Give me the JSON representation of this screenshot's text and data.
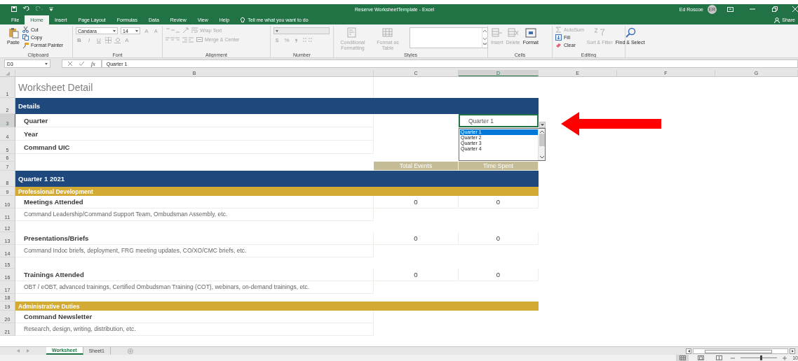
{
  "window": {
    "title": "Reserve WorksheetTemplate  -  Excel",
    "user": "Ed Roscoe",
    "avatar": "ER"
  },
  "ribbon_tabs": [
    {
      "label": "File",
      "selected": false
    },
    {
      "label": "Home",
      "selected": true
    },
    {
      "label": "Insert",
      "selected": false
    },
    {
      "label": "Page Layout",
      "selected": false
    },
    {
      "label": "Formulas",
      "selected": false
    },
    {
      "label": "Data",
      "selected": false
    },
    {
      "label": "Review",
      "selected": false
    },
    {
      "label": "View",
      "selected": false
    },
    {
      "label": "Help",
      "selected": false
    }
  ],
  "tell_me": "Tell me what you want to do",
  "share": "Share",
  "ribbon": {
    "groups": [
      {
        "kind": "stacked",
        "label": "Clipboard",
        "items": [
          {
            "kind": "paste",
            "label": "Paste",
            "disabled": false
          },
          {
            "kind": "cut",
            "label": "Cut",
            "disabled": false
          },
          {
            "kind": "copy",
            "label": "Copy",
            "disabled": false
          },
          {
            "kind": "format_painter",
            "label": "Format Painter",
            "disabled": false
          }
        ]
      },
      {
        "kind": "lines",
        "label": "Font",
        "lines": [
          [
            {
              "kind": "font_name",
              "value": "Candara",
              "disabled": false
            },
            {
              "kind": "font_size",
              "value": "14",
              "disabled": false
            },
            {
              "kind": "grow",
              "label": "A",
              "disabled": true
            },
            {
              "kind": "shrink",
              "label": "A",
              "disabled": true
            }
          ],
          [
            {
              "kind": "bold",
              "label": "B",
              "disabled": true
            },
            {
              "kind": "italic",
              "label": "I",
              "disabled": true
            },
            {
              "kind": "underline",
              "label": "U",
              "disabled": true
            },
            {
              "kind": "borders",
              "disabled": true
            },
            {
              "kind": "fill_color",
              "disabled": true
            },
            {
              "kind": "font_color",
              "label": "A",
              "disabled": true
            }
          ]
        ]
      },
      {
        "kind": "lines",
        "label": "Alignment",
        "lines": [
          [
            {
              "kind": "valign",
              "disabled": true
            },
            {
              "kind": "orient",
              "disabled": true
            },
            {
              "kind": "wrap_text",
              "label": "Wrap Text",
              "disabled": true
            }
          ],
          [
            {
              "kind": "halign",
              "disabled": true
            },
            {
              "kind": "indent",
              "disabled": true
            },
            {
              "kind": "merge",
              "label": "Merge & Center",
              "disabled": true
            }
          ]
        ]
      },
      {
        "kind": "lines",
        "label": "Number",
        "lines": [
          [
            {
              "kind": "number_format",
              "disabled": true
            }
          ],
          [
            {
              "kind": "currency",
              "label": "$",
              "disabled": true
            },
            {
              "kind": "percent",
              "label": "%",
              "disabled": true
            },
            {
              "kind": "comma",
              "disabled": true
            },
            {
              "kind": "decimals",
              "disabled": true
            }
          ]
        ]
      },
      {
        "kind": "stacked",
        "label": "Styles",
        "items": [
          {
            "kind": "conditional",
            "label": "Conditional Formatting",
            "disabled": true
          },
          {
            "kind": "table_format",
            "label": "Format as Table",
            "disabled": true
          },
          {
            "kind": "gallery",
            "disabled": false
          }
        ]
      },
      {
        "kind": "stacked",
        "label": "Cells",
        "items": [
          {
            "kind": "insert_cells",
            "label": "Insert",
            "disabled": true
          },
          {
            "kind": "delete_cells",
            "label": "Delete",
            "disabled": true
          },
          {
            "kind": "format_cells",
            "label": "Format",
            "disabled": false
          }
        ]
      },
      {
        "kind": "stacked",
        "label": "Editing",
        "items": [
          {
            "kind": "autosum",
            "label": "AutoSum",
            "disabled": true
          },
          {
            "kind": "fill",
            "label": "Fill",
            "disabled": false
          },
          {
            "kind": "clear",
            "label": "Clear",
            "disabled": false
          },
          {
            "kind": "sort_filter",
            "label": "Sort & Filter",
            "disabled": true
          },
          {
            "kind": "find",
            "label": "Find & Select",
            "disabled": false
          }
        ]
      }
    ]
  },
  "formula_bar": {
    "name_box": "D3",
    "function_label": "fx",
    "formula": "Quarter 1"
  },
  "columns": [
    {
      "label": "B",
      "selected": false
    },
    {
      "label": "C",
      "selected": false
    },
    {
      "label": "D",
      "selected": true
    },
    {
      "label": "E",
      "selected": false
    },
    {
      "label": "F",
      "selected": false
    },
    {
      "label": "G",
      "selected": false
    }
  ],
  "rows": [
    {
      "number": "1",
      "kind": "title",
      "text": "Worksheet Detail",
      "selected": false
    },
    {
      "number": "2",
      "kind": "band",
      "text": "Details",
      "selected": false
    },
    {
      "number": "3",
      "kind": "field",
      "text": "Quarter",
      "value": "Quarter 1",
      "selected": true
    },
    {
      "number": "4",
      "kind": "field",
      "text": "Year",
      "selected": false
    },
    {
      "number": "5",
      "kind": "field",
      "text": "Command UIC",
      "selected": false
    },
    {
      "number": "6",
      "kind": "gap",
      "selected": false
    },
    {
      "number": "7",
      "kind": "header",
      "total_events": "Total Events",
      "time_spent": "Time Spent",
      "selected": false
    },
    {
      "number": "8",
      "kind": "band",
      "text": "Quarter 1 2021",
      "selected": false
    },
    {
      "number": "9",
      "kind": "section",
      "text": "Professional Development",
      "selected": false
    },
    {
      "number": "10",
      "kind": "item",
      "text": "Meetings Attended",
      "total_events": "0",
      "time_spent": "0",
      "selected": false
    },
    {
      "number": "11",
      "kind": "desc",
      "text": "Command Leadership/Command Support Team, Ombudsman Assembly, etc.",
      "selected": false
    },
    {
      "number": "12",
      "kind": "blank",
      "selected": false
    },
    {
      "number": "13",
      "kind": "item",
      "text": "Presentations/Briefs",
      "total_events": "0",
      "time_spent": "0",
      "selected": false
    },
    {
      "number": "14",
      "kind": "desc",
      "text": "Command Indoc briefs, deployment, FRG meeting updates, CO/XO/CMC briefs, etc.",
      "selected": false
    },
    {
      "number": "15",
      "kind": "blank",
      "selected": false
    },
    {
      "number": "16",
      "kind": "item",
      "text": "Trainings Attended",
      "total_events": "0",
      "time_spent": "0",
      "selected": false
    },
    {
      "number": "17",
      "kind": "desc",
      "text": "OBT / eOBT, advanced trainings, Certified Ombudsman Training (COT), webinars, on-demand trainings, etc.",
      "selected": false
    },
    {
      "number": "18",
      "kind": "gap",
      "selected": false
    },
    {
      "number": "19",
      "kind": "section",
      "text": "Administrative Duties",
      "selected": false
    },
    {
      "number": "20",
      "kind": "item",
      "text": "Command Newsletter",
      "selected": false
    },
    {
      "number": "21",
      "kind": "desc",
      "text": "Research, design, writing, distribution, etc.",
      "selected": false
    }
  ],
  "dropdown": {
    "options": [
      {
        "label": "Quarter 1",
        "selected": true
      },
      {
        "label": "Quarter 2",
        "selected": false
      },
      {
        "label": "Quarter 3",
        "selected": false
      },
      {
        "label": "Quarter 4",
        "selected": false
      }
    ]
  },
  "sheet_tabs": [
    {
      "label": "Worksheet",
      "selected": true
    },
    {
      "label": "Sheet1",
      "selected": false
    }
  ],
  "status_bar": {
    "zoom_slider": {
      "level": 0.55
    },
    "zoom": "10"
  }
}
